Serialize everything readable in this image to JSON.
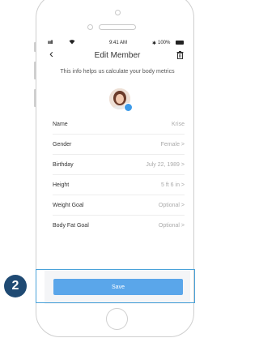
{
  "status_bar": {
    "signal": "ıııll",
    "time": "9:41 AM",
    "bluetooth": "✱",
    "battery": "100%"
  },
  "header": {
    "back_icon": "‹",
    "title": "Edit Member",
    "delete_icon": "trash-icon"
  },
  "hint": "This info helps us calculate your body metrics",
  "fields": [
    {
      "label": "Name",
      "value": "Krise"
    },
    {
      "label": "Gender",
      "value": "Female  >"
    },
    {
      "label": "Birthday",
      "value": "July 22, 1989  >"
    },
    {
      "label": "Height",
      "value": "5 ft 6 in  >"
    },
    {
      "label": "Weight Goal",
      "value": "Optional  >"
    },
    {
      "label": "Body Fat Goal",
      "value": "Optional  >"
    }
  ],
  "save_label": "Save",
  "step_number": "2",
  "colors": {
    "accent": "#5aa6ea",
    "badge": "#1f4a73",
    "highlight": "#4aa2d9"
  }
}
